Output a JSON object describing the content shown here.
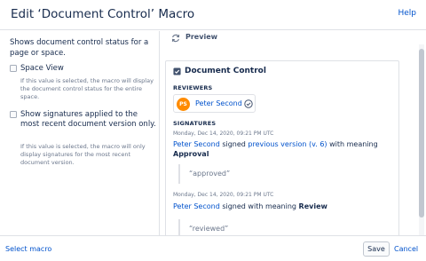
{
  "dialog": {
    "title": "Edit ‘Document Control’ Macro",
    "help_label": "Help"
  },
  "options_panel": {
    "intro": "Shows document control status for a page or space.",
    "options": [
      {
        "label": "Space View",
        "checked": false,
        "help": "If this value is selected, the macro will display the document control status for the entire space."
      },
      {
        "label": "Show signatures applied to the most recent document version only.",
        "checked": false,
        "help": "If this value is selected, the macro will only display signatures for the most recent document version."
      }
    ]
  },
  "preview": {
    "label": "Preview",
    "card": {
      "title": "Document Control",
      "reviewers_heading": "REVIEWERS",
      "reviewer": {
        "initials": "PS",
        "name": "Peter Second",
        "avatar_color": "#ff8b00"
      },
      "signatures_heading": "SIGNATURES",
      "signatures": [
        {
          "timestamp": "Monday, Dec 14, 2020, 09:21 PM UTC",
          "signer": "Peter Second",
          "action": " signed ",
          "version_link": "previous version (v. 6)",
          "meaning_text": " with meaning ",
          "meaning": "Approval",
          "comment": "“approved”"
        },
        {
          "timestamp": "Monday, Dec 14, 2020, 09:21 PM UTC",
          "signer": "Peter Second",
          "action": " signed with meaning ",
          "meaning": "Review",
          "comment": "“reviewed”"
        }
      ]
    }
  },
  "footer": {
    "select_macro_label": "Select macro",
    "save_label": "Save",
    "cancel_label": "Cancel"
  },
  "colors": {
    "link": "#0052cc",
    "text": "#172b4d",
    "muted": "#6b778c",
    "border": "#dfe1e6"
  },
  "icons": {
    "preview": "refresh-icon",
    "card": "document-control-icon",
    "reviewer_status": "check-circle-icon"
  }
}
